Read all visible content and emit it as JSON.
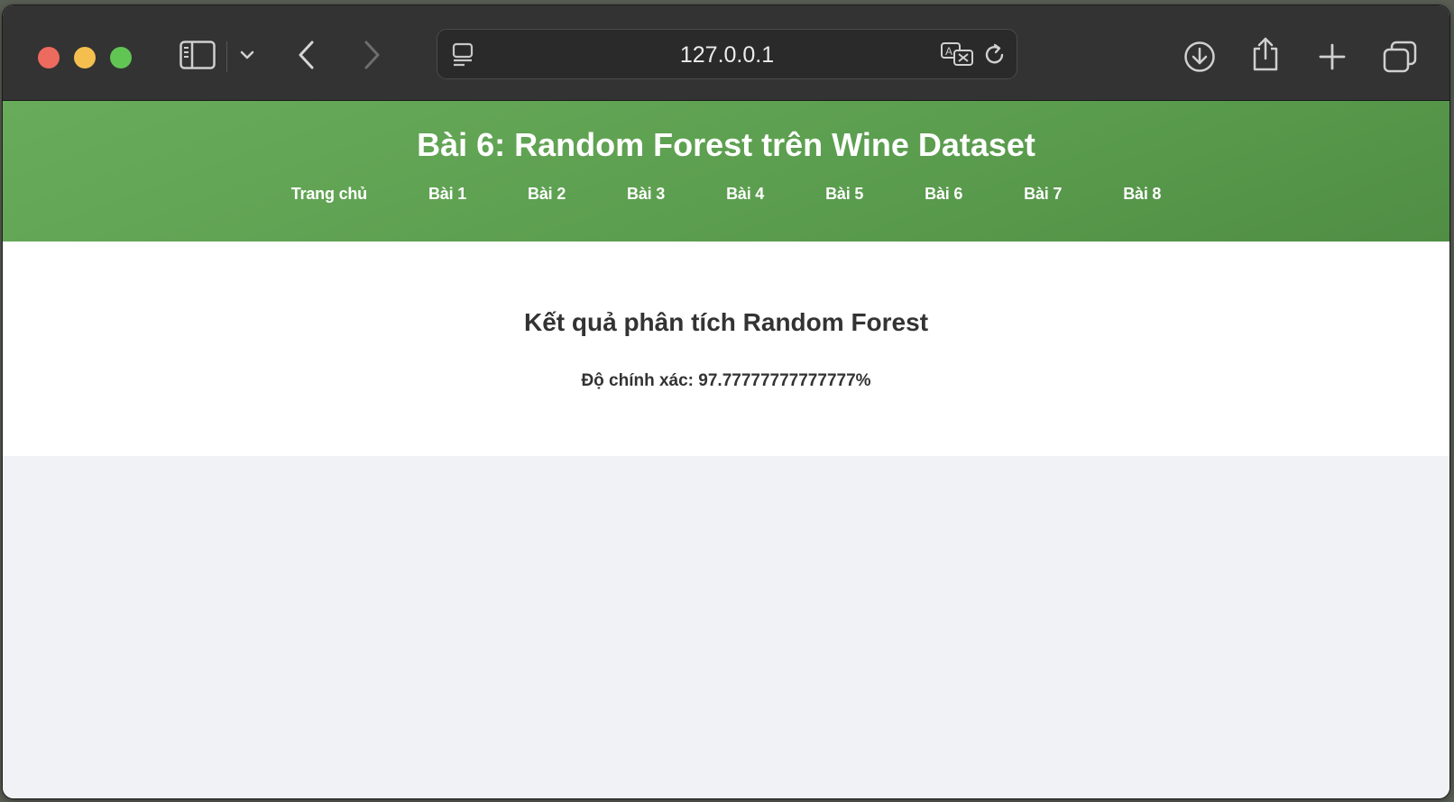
{
  "browser": {
    "url": "127.0.0.1",
    "icons": {
      "sidebar": "sidebar-icon",
      "tab_menu": "chevron-down-icon",
      "back": "back-arrow-icon",
      "forward": "forward-arrow-icon",
      "page_menu": "page-menu-icon",
      "translate": "translate-icon",
      "reload": "reload-icon",
      "download": "download-icon",
      "share": "share-icon",
      "new_tab": "plus-icon",
      "tabs_overview": "tabs-overview-icon"
    }
  },
  "header": {
    "title": "Bài 6: Random Forest trên Wine Dataset",
    "nav": [
      "Trang chủ",
      "Bài 1",
      "Bài 2",
      "Bài 3",
      "Bài 4",
      "Bài 5",
      "Bài 6",
      "Bài 7",
      "Bài 8"
    ],
    "color": "#5fa253"
  },
  "main": {
    "heading": "Kết quả phân tích Random Forest",
    "accuracy_text": "Độ chính xác: 97.77777777777777%"
  }
}
